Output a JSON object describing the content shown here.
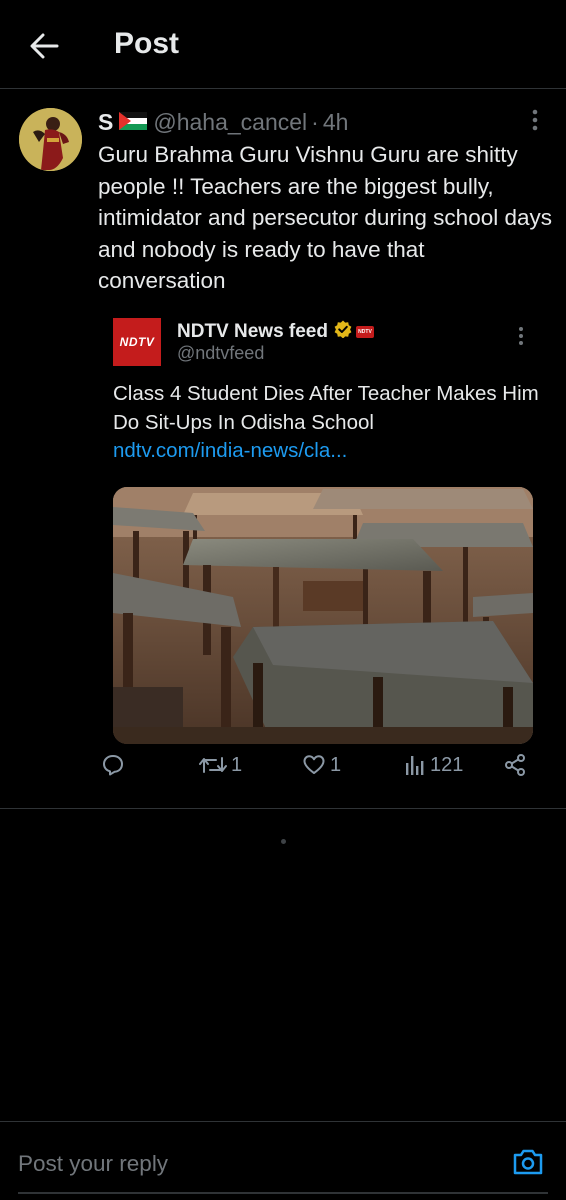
{
  "header": {
    "title": "Post",
    "back_icon": "arrow-left-icon"
  },
  "post": {
    "display_name": "S",
    "flag_icon": "palestine-flag-icon",
    "handle": "@haha_cancel",
    "separator": "·",
    "timestamp": "4h",
    "text": "Guru Brahma Guru Vishnu Guru are shitty people !! Teachers are the biggest bully, intimidator and persecutor during school days and nobody is ready to have that conversation",
    "quote": {
      "logo_text": "NDTV",
      "name": "NDTV News feed",
      "handle": "@ndtvfeed",
      "text": "Class 4 Student Dies After Teacher Makes Him Do Sit-Ups In Odisha School",
      "link": "ndtv.com/india-news/cla...",
      "image_icon": "classroom-desks-image"
    },
    "actions": {
      "reply_count": "",
      "repost_count": "1",
      "like_count": "1",
      "views_count": "121"
    }
  },
  "reply": {
    "placeholder": "Post your reply"
  },
  "colors": {
    "background": "#000000",
    "accent": "#1d9bf0",
    "muted": "#71767b",
    "ndtv_red": "#c41c1c"
  }
}
